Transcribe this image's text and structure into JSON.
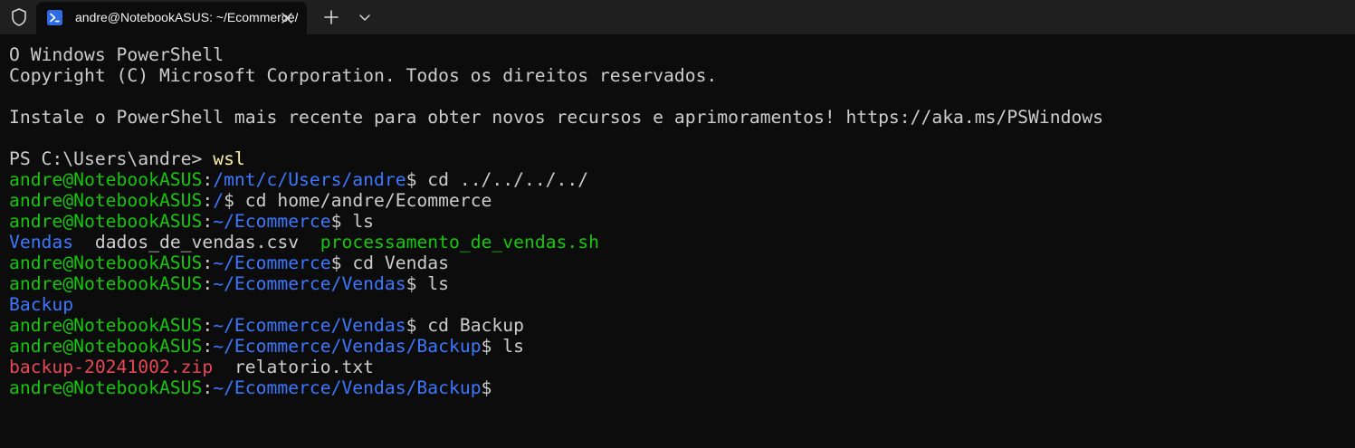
{
  "window": {
    "tab_title": "andre@NotebookASUS: ~/Ecommerce/Vendas/Backup"
  },
  "icons": {
    "shield": "shield-icon",
    "powershell": "powershell-icon",
    "close": "close-icon",
    "new_tab": "plus-icon",
    "dropdown": "chevron-down-icon"
  },
  "colors": {
    "background": "#0c0c0c",
    "titlebar": "#1f1f1f",
    "text": "#cccccc",
    "user_host": "#16c60c",
    "path": "#3b78ff",
    "command_highlight": "#f9f1a5",
    "archive": "#e74856",
    "executable": "#16c60c"
  },
  "terminal": {
    "l1": "O Windows PowerShell",
    "l2": "Copyright (C) Microsoft Corporation. Todos os direitos reservados.",
    "l4": "Instale o PowerShell mais recente para obter novos recursos e aprimoramentos! https://aka.ms/PSWindows",
    "ps_prompt": "PS C:\\Users\\andre> ",
    "ps_cmd": "wsl",
    "user_host": "andre@NotebookASUS",
    "colon": ":",
    "dollar": "$",
    "c1_path": "/mnt/c/Users/andre",
    "c1_cmd": " cd ../../../../",
    "c2_path": "/",
    "c2_cmd": " cd home/andre/Ecommerce",
    "c3_path": "~/Ecommerce",
    "c3_cmd": " ls",
    "ls1_dir": "Vendas",
    "ls1_sep1": "  ",
    "ls1_file": "dados_de_vendas.csv",
    "ls1_sep2": "  ",
    "ls1_exec": "processamento_de_vendas.sh",
    "c4_path": "~/Ecommerce",
    "c4_cmd": " cd Vendas",
    "c5_path": "~/Ecommerce/Vendas",
    "c5_cmd": " ls",
    "ls2_dir": "Backup",
    "c6_path": "~/Ecommerce/Vendas",
    "c6_cmd": " cd Backup",
    "c7_path": "~/Ecommerce/Vendas/Backup",
    "c7_cmd": " ls",
    "ls3_zip": "backup-20241002.zip",
    "ls3_sep": "  ",
    "ls3_file": "relatorio.txt",
    "c8_path": "~/Ecommerce/Vendas/Backup"
  }
}
